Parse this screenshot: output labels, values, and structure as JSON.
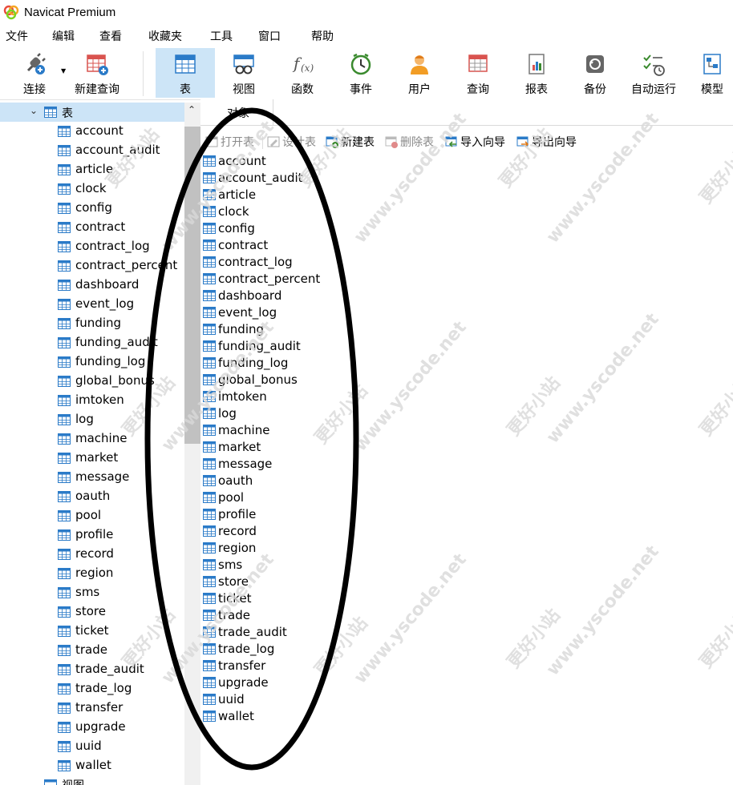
{
  "app": {
    "title": "Navicat Premium"
  },
  "menu": [
    "文件",
    "编辑",
    "查看",
    "收藏夹",
    "工具",
    "窗口",
    "帮助"
  ],
  "toolbar": {
    "connect": "连接",
    "new_query": "新建查询",
    "items": [
      {
        "label": "表",
        "icon": "table-icon",
        "active": true
      },
      {
        "label": "视图",
        "icon": "view-icon"
      },
      {
        "label": "函数",
        "icon": "function-icon"
      },
      {
        "label": "事件",
        "icon": "event-clock-icon"
      },
      {
        "label": "用户",
        "icon": "user-icon"
      },
      {
        "label": "查询",
        "icon": "query-icon"
      },
      {
        "label": "报表",
        "icon": "report-icon"
      },
      {
        "label": "备份",
        "icon": "backup-icon"
      },
      {
        "label": "自动运行",
        "icon": "automation-icon"
      },
      {
        "label": "模型",
        "icon": "model-icon"
      }
    ]
  },
  "tree": {
    "root_label": "表",
    "tables": [
      "account",
      "account_audit",
      "article",
      "clock",
      "config",
      "contract",
      "contract_log",
      "contract_percent",
      "dashboard",
      "event_log",
      "funding",
      "funding_audit",
      "funding_log",
      "global_bonus",
      "imtoken",
      "log",
      "machine",
      "market",
      "message",
      "oauth",
      "pool",
      "profile",
      "record",
      "region",
      "sms",
      "store",
      "ticket",
      "trade",
      "trade_audit",
      "trade_log",
      "transfer",
      "upgrade",
      "uuid",
      "wallet"
    ],
    "next_node_label": "视图"
  },
  "objects_tab": {
    "label": "对象"
  },
  "object_toolbar": {
    "open_table": "打开表",
    "design_table": "设计表",
    "new_table": "新建表",
    "delete_table": "删除表",
    "import_wizard": "导入向导",
    "export_wizard": "导出向导"
  },
  "object_list": [
    "account",
    "account_audit",
    "article",
    "clock",
    "config",
    "contract",
    "contract_log",
    "contract_percent",
    "dashboard",
    "event_log",
    "funding",
    "funding_audit",
    "funding_log",
    "global_bonus",
    "imtoken",
    "log",
    "machine",
    "market",
    "message",
    "oauth",
    "pool",
    "profile",
    "record",
    "region",
    "sms",
    "store",
    "ticket",
    "trade",
    "trade_audit",
    "trade_log",
    "transfer",
    "upgrade",
    "uuid",
    "wallet"
  ],
  "watermark": {
    "text1": "更好小站",
    "text2": "www.yscode.net"
  },
  "colors": {
    "selected_bg": "#cce4f7",
    "toolbar_active_bg": "#cde5f7",
    "table_icon": "#2b7bc8"
  }
}
